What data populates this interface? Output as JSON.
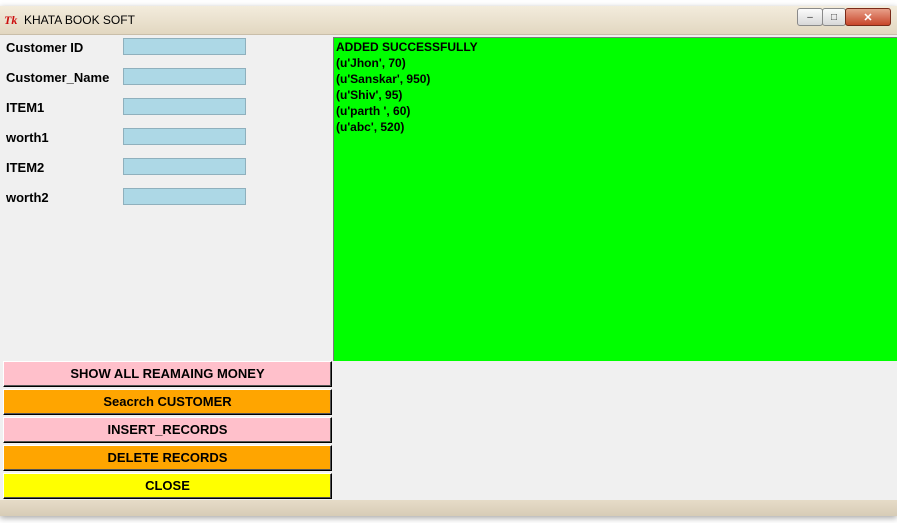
{
  "window": {
    "title": "KHATA BOOK SOFT",
    "icon": "Tk",
    "controls": {
      "minimize": "–",
      "maximize": "□",
      "close": "✕"
    }
  },
  "form": {
    "fields": [
      {
        "label": "Customer ID",
        "value": ""
      },
      {
        "label": "Customer_Name",
        "value": ""
      },
      {
        "label": "ITEM1",
        "value": ""
      },
      {
        "label": "worth1",
        "value": ""
      },
      {
        "label": "ITEM2",
        "value": ""
      },
      {
        "label": "worth2",
        "value": ""
      }
    ]
  },
  "output": {
    "background": "#00ff00",
    "lines": [
      "ADDED SUCCESSFULLY",
      "(u'Jhon', 70)",
      "(u'Sanskar', 950)",
      "(u'Shiv', 95)",
      "(u'parth ', 60)",
      "(u'abc', 520)"
    ]
  },
  "buttons": [
    {
      "label": "SHOW ALL REAMAING MONEY",
      "color": "#ffc0cb"
    },
    {
      "label": "Seacrch CUSTOMER",
      "color": "#ffa500"
    },
    {
      "label": "INSERT_RECORDS",
      "color": "#ffc0cb"
    },
    {
      "label": "DELETE RECORDS",
      "color": "#ffa500"
    },
    {
      "label": "CLOSE",
      "color": "#ffff00"
    }
  ]
}
